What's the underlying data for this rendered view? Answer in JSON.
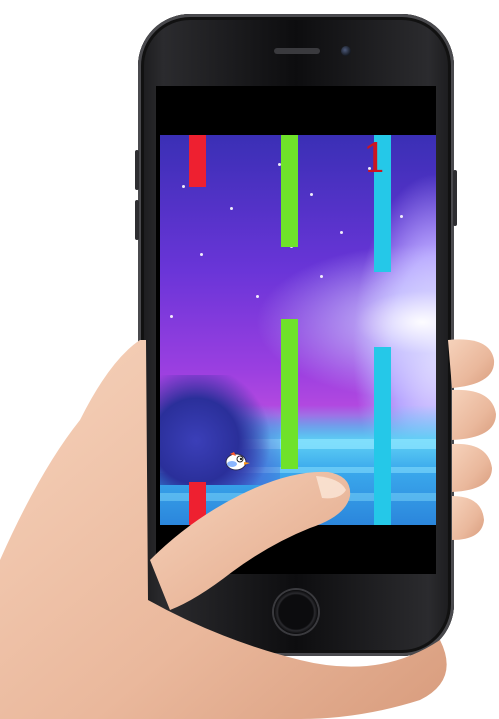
{
  "game": {
    "score": "1"
  },
  "colors": {
    "pipe_red": "#ee2030",
    "pipe_green": "#6fe22a",
    "pipe_cyan": "#25c8e8",
    "score_red": "#cc1520",
    "background_top": "#3a2fb5",
    "background_mid": "#9a3fe0",
    "ground": "#38c6f0",
    "device_body": "#1a1a1c",
    "skin": "#f0c3a8"
  },
  "icons": {
    "player": "bird-icon",
    "home": "home-button-icon"
  }
}
